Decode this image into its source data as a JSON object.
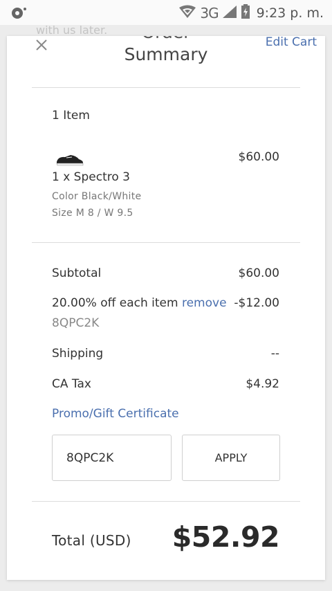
{
  "status_bar": {
    "network": "3G",
    "time": "9:23 p. m."
  },
  "background_text": "with us later.",
  "header": {
    "title_top": "Order",
    "title": "Summary",
    "edit_cart": "Edit Cart"
  },
  "cart": {
    "item_count": "1 Item",
    "item": {
      "name": "1 x Spectro 3",
      "color": "Color Black/White",
      "size": "Size M 8 / W 9.5",
      "price": "$60.00"
    }
  },
  "summary": {
    "subtotal_label": "Subtotal",
    "subtotal_value": "$60.00",
    "discount_label": "20.00% off each item",
    "discount_remove": "remove",
    "discount_value": "-$12.00",
    "discount_code": "8QPC2K",
    "shipping_label": "Shipping",
    "shipping_value": "--",
    "tax_label": "CA Tax",
    "tax_value": "$4.92",
    "promo_link": "Promo/Gift Certificate"
  },
  "promo": {
    "input_value": "8QPC2K",
    "apply_label": "APPLY"
  },
  "total": {
    "label": "Total (USD)",
    "value": "$52.92"
  }
}
